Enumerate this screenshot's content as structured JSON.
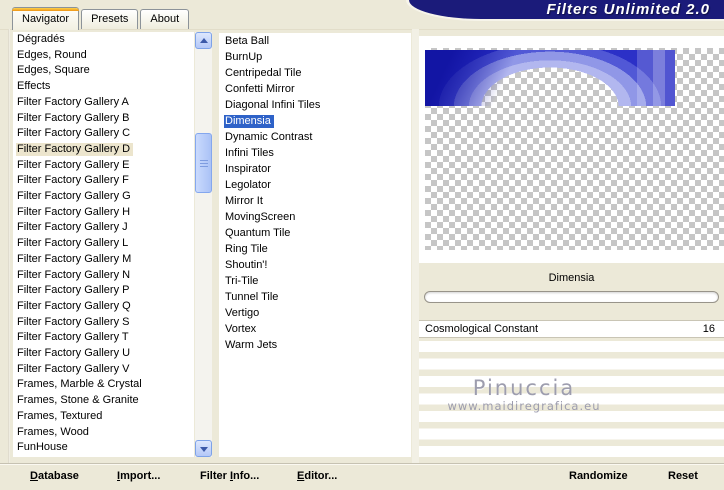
{
  "header": {
    "title": "Filters Unlimited 2.0",
    "banner_color": "#1b1b7a",
    "tabs": [
      {
        "label": "Navigator",
        "active": true
      },
      {
        "label": "Presets",
        "active": false
      },
      {
        "label": "About",
        "active": false
      }
    ]
  },
  "categories": {
    "selected": "Filter Factory Gallery D",
    "selected_color": "#ece5cd",
    "items": [
      "Dégradés",
      "Edges, Round",
      "Edges, Square",
      "Effects",
      "Filter Factory Gallery A",
      "Filter Factory Gallery B",
      "Filter Factory Gallery C",
      "Filter Factory Gallery D",
      "Filter Factory Gallery E",
      "Filter Factory Gallery F",
      "Filter Factory Gallery G",
      "Filter Factory Gallery H",
      "Filter Factory Gallery J",
      "Filter Factory Gallery L",
      "Filter Factory Gallery M",
      "Filter Factory Gallery N",
      "Filter Factory Gallery P",
      "Filter Factory Gallery Q",
      "Filter Factory Gallery S",
      "Filter Factory Gallery T",
      "Filter Factory Gallery U",
      "Filter Factory Gallery V",
      "Frames, Marble & Crystal",
      "Frames, Stone & Granite",
      "Frames, Textured",
      "Frames, Wood",
      "FunHouse"
    ]
  },
  "filters": {
    "selected": "Dimensia",
    "selected_color": "#2e62c8",
    "items": [
      "Beta Ball",
      "BurnUp",
      "Centripedal Tile",
      "Confetti Mirror",
      "Diagonal Infini Tiles",
      "Dimensia",
      "Dynamic Contrast",
      "Infini Tiles",
      "Inspirator",
      "Legolator",
      "Mirror It",
      "MovingScreen",
      "Quantum Tile",
      "Ring Tile",
      "Shoutin'!",
      "Tri-Tile",
      "Tunnel Tile",
      "Vertigo",
      "Vortex",
      "Warm Jets"
    ]
  },
  "preview": {
    "filter_name": "Dimensia",
    "checker_gray": "#c6c6c6",
    "image_blues": [
      "#1b1fb8",
      "#5158d6",
      "#9097e7",
      "#b2b7ef"
    ]
  },
  "parameters": [
    {
      "name": "Cosmological Constant",
      "value": "16"
    }
  ],
  "watermark": {
    "name": "Pinuccia",
    "url": "www.maidiregrafica.eu"
  },
  "footer": {
    "database": {
      "pre": "",
      "key": "D",
      "post": "atabase"
    },
    "import": {
      "pre": "",
      "key": "I",
      "post": "mport..."
    },
    "filter_info": {
      "pre": "Filter ",
      "key": "I",
      "post": "nfo..."
    },
    "editor": {
      "pre": "",
      "key": "E",
      "post": "ditor..."
    },
    "randomize": "Randomize",
    "reset": "Reset"
  },
  "icons": {
    "scroll_up": "scroll-up-arrow",
    "scroll_down": "scroll-down-arrow"
  }
}
